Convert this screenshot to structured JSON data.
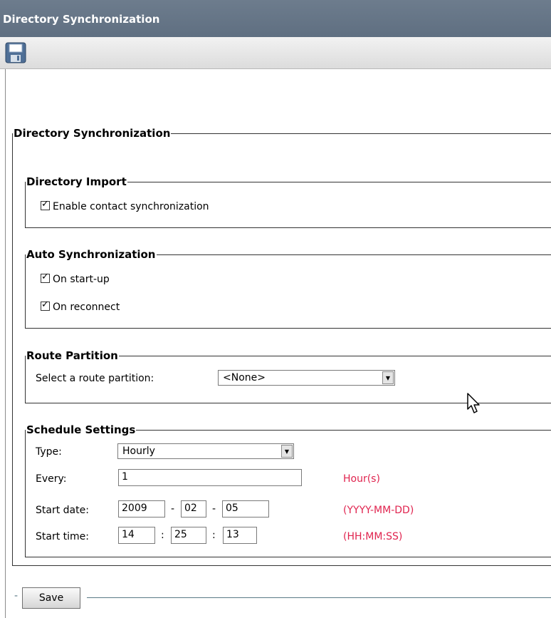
{
  "window": {
    "title": "Directory Synchronization"
  },
  "toolbar": {
    "save_icon": "floppy-disk-icon"
  },
  "main": {
    "legend": "Directory Synchronization",
    "directory_import": {
      "legend": "Directory Import",
      "enable_contact_sync": {
        "label": "Enable contact synchronization",
        "checked": true
      }
    },
    "auto_sync": {
      "legend": "Auto Synchronization",
      "on_startup": {
        "label": "On start-up",
        "checked": true
      },
      "on_reconnect": {
        "label": "On reconnect",
        "checked": true
      }
    },
    "route_partition": {
      "legend": "Route Partition",
      "label": "Select a route partition:",
      "selected": "<None>"
    },
    "schedule": {
      "legend": "Schedule Settings",
      "type_label": "Type:",
      "type_value": "Hourly",
      "every_label": "Every:",
      "every_value": "1",
      "every_unit": "Hour(s)",
      "start_date_label": "Start date:",
      "start_date": {
        "year": "2009",
        "month": "02",
        "day": "05"
      },
      "date_sep": "-",
      "date_format": "(YYYY-MM-DD)",
      "start_time_label": "Start time:",
      "start_time": {
        "hour": "14",
        "minute": "25",
        "second": "13"
      },
      "time_sep": ":",
      "time_format": "(HH:MM:SS)"
    }
  },
  "footer": {
    "save_label": "Save",
    "dash": "-"
  },
  "colors": {
    "titlebar": "#64748a",
    "hint": "#e0244f"
  }
}
